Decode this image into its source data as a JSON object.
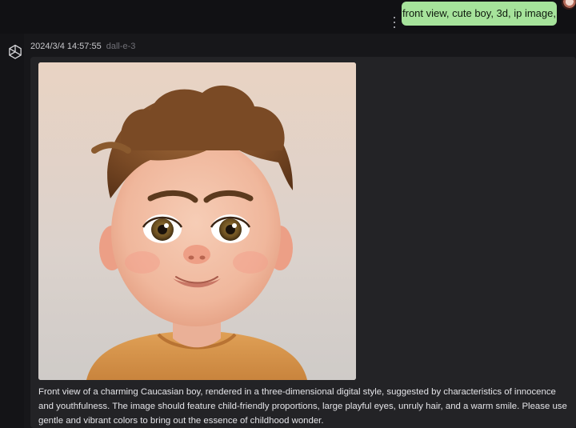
{
  "user_message": {
    "text": "front view, cute boy, 3d, ip image,"
  },
  "assistant_message": {
    "timestamp": "2024/3/4 14:57:55",
    "model": "dall-e-3",
    "revised_prompt": "Front view of a charming Caucasian boy, rendered in a three-dimensional digital style, suggested by characteristics of innocence and youthfulness. The image should feature child-friendly proportions, large playful eyes, unruly hair, and a warm smile. Please use gentle and vibrant colors to bring out the essence of childhood wonder."
  },
  "icons": {
    "assistant_avatar": "openai-logo-icon",
    "message_menu": "more-vertical-icon",
    "user_avatar": "user-avatar-icon"
  },
  "colors": {
    "background": "#17171a",
    "user_bubble": "#a6e39b",
    "message_card": "#232326"
  }
}
